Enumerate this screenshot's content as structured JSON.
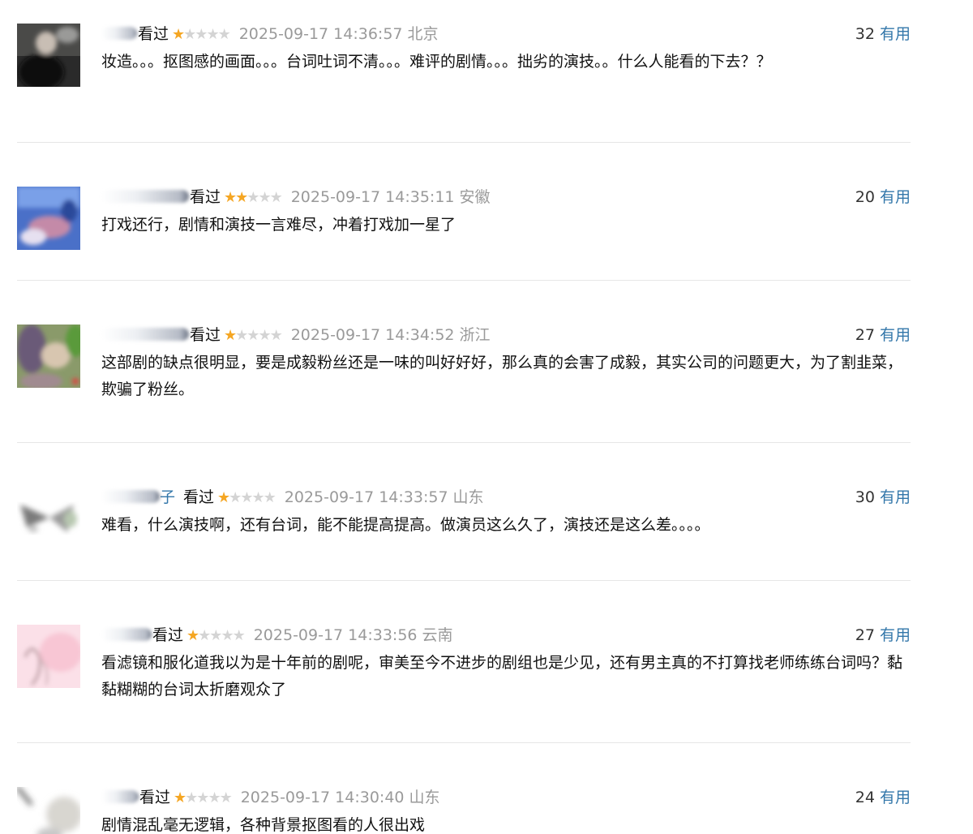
{
  "comments": [
    {
      "name_visible": "",
      "status": "看过",
      "rating": 1,
      "time": "2025-09-17 14:36:57",
      "location": "北京",
      "votes": "32",
      "useful_label": "有用",
      "text": "妆造。。。抠图感的画面。。。台词吐词不清。。。难评的剧情。。。拙劣的演技。。什么人能看的下去？？",
      "avatar": "dark-portrait"
    },
    {
      "name_visible": "",
      "status": "看过",
      "rating": 2,
      "time": "2025-09-17 14:35:11",
      "location": "安徽",
      "votes": "20",
      "useful_label": "有用",
      "text": "打戏还行，剧情和演技一言难尽，冲着打戏加一星了",
      "avatar": "blue-stage"
    },
    {
      "name_visible": "",
      "status": "看过",
      "rating": 1,
      "time": "2025-09-17 14:34:52",
      "location": "浙江",
      "votes": "27",
      "useful_label": "有用",
      "text": "这部剧的缺点很明显，要是成毅粉丝还是一味的叫好好好，那么真的会害了成毅，其实公司的问题更大，为了割韭菜，欺骗了粉丝。",
      "avatar": "green-plant"
    },
    {
      "name_visible": "子",
      "status": "看过",
      "rating": 1,
      "time": "2025-09-17 14:33:57",
      "location": "山东",
      "votes": "30",
      "useful_label": "有用",
      "text": "难看，什么演技啊，还有台词，能不能提高提高。做演员这么久了，演技还是这么差。。。。",
      "avatar": "grey-bird"
    },
    {
      "name_visible": "",
      "status": "看过",
      "rating": 1,
      "time": "2025-09-17 14:33:56",
      "location": "云南",
      "votes": "27",
      "useful_label": "有用",
      "text": "看滤镜和服化道我以为是十年前的剧呢，审美至今不进步的剧组也是少见，还有男主真的不打算找老师练练台词吗？黏黏糊糊的台词太折磨观众了",
      "avatar": "pink-sketch"
    },
    {
      "name_visible": "",
      "status": "看过",
      "rating": 1,
      "time": "2025-09-17 14:30:40",
      "location": "山东",
      "votes": "24",
      "useful_label": "有用",
      "text": "剧情混乱毫无逻辑，各种背景抠图看的人很出戏",
      "avatar": "grey-blur"
    }
  ],
  "colors": {
    "link": "#3377aa",
    "star_on": "#f5a623",
    "star_off": "#d4d4d4",
    "meta_text": "#9a9a9a",
    "divider": "#e6e6e6"
  },
  "icons": {
    "star": "★"
  }
}
